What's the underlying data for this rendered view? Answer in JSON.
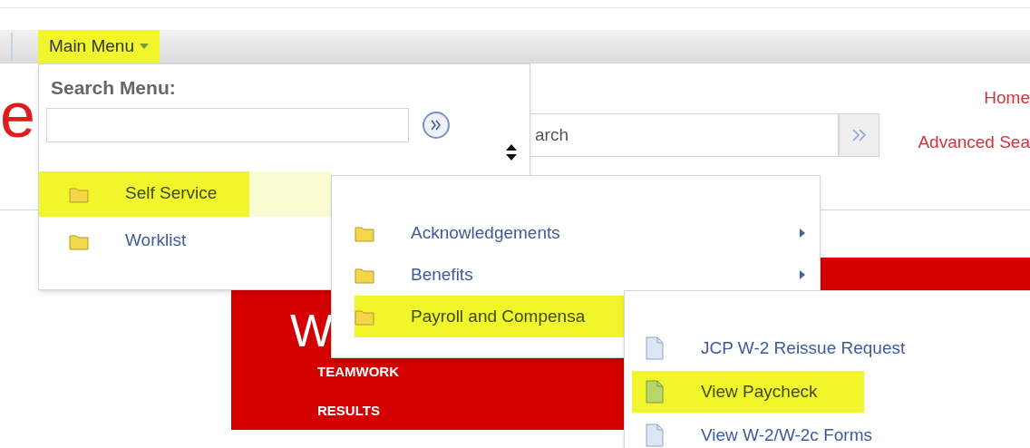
{
  "nav": {
    "main_menu": {
      "label": "Main Menu",
      "selected": true
    }
  },
  "header": {
    "logo_fragment": "e",
    "search": {
      "value": "arch"
    },
    "links": [
      "Home",
      "Advanced Sea"
    ]
  },
  "banner": {
    "letter": "W",
    "lines": [
      "TEAMWORK",
      "RESULTS"
    ]
  },
  "menus": [
    {
      "title": "Search Menu:",
      "items": [
        {
          "label": "Self Service",
          "kind": "folder",
          "selected": true,
          "submenu": false
        },
        {
          "label": "Worklist",
          "kind": "folder",
          "selected": false,
          "submenu": false
        }
      ]
    },
    {
      "items": [
        {
          "label": "Acknowledgements",
          "kind": "folder",
          "selected": false,
          "submenu": true
        },
        {
          "label": "Benefits",
          "kind": "folder",
          "selected": false,
          "submenu": true
        },
        {
          "label": "Payroll and Compensa",
          "kind": "folder",
          "selected": true,
          "submenu": false
        }
      ]
    },
    {
      "items": [
        {
          "label": "JCP W-2 Reissue Request",
          "kind": "page",
          "selected": false,
          "submenu": false
        },
        {
          "label": "View Paycheck",
          "kind": "page",
          "selected": true,
          "submenu": false
        },
        {
          "label": "View W-2/W-2c Forms",
          "kind": "page",
          "selected": false,
          "submenu": false
        }
      ]
    }
  ]
}
